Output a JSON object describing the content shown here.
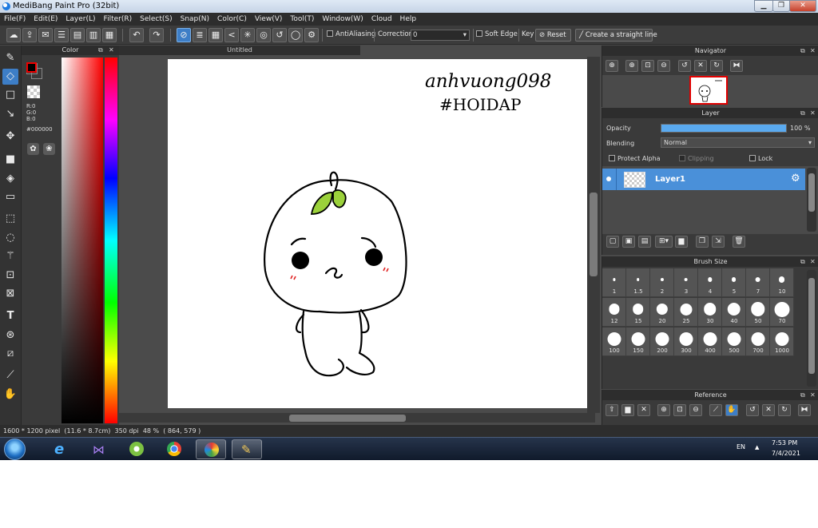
{
  "window": {
    "title": "MediBang Paint Pro (32bit)",
    "min_label": "▁",
    "max_label": "❐",
    "close_label": "✕"
  },
  "menu": [
    "File(F)",
    "Edit(E)",
    "Layer(L)",
    "Filter(R)",
    "Select(S)",
    "Snap(N)",
    "Color(C)",
    "View(V)",
    "Tool(T)",
    "Window(W)",
    "Cloud",
    "Help"
  ],
  "toolbar": {
    "antialiasing": "AntiAliasing",
    "correction_label": "Correction",
    "correction_value": "0",
    "soft_edge": "Soft Edge",
    "key": "Key",
    "reset": "Reset",
    "straight_line": "Create a straight line"
  },
  "color_panel": {
    "title": "Color",
    "r": "R:0",
    "g": "G:0",
    "b": "B:0",
    "hex": "#000000",
    "primary": "#000000",
    "secondary": "#ff0000"
  },
  "document": {
    "tab": "Untitled",
    "handwriting_line1": "anhvuong098",
    "handwriting_line2": "#HOIDAP"
  },
  "status": {
    "size": "1600 * 1200 pixel",
    "physical": "(11.6 * 8.7cm)",
    "dpi": "350 dpi",
    "zoom": "48 %",
    "coords": "( 864, 579 )"
  },
  "navigator": {
    "title": "Navigator"
  },
  "layer_panel": {
    "title": "Layer",
    "opacity_label": "Opacity",
    "opacity_value": "100 %",
    "opacity_fraction": 1.0,
    "blending_label": "Blending",
    "blending_value": "Normal",
    "protect_alpha": "Protect Alpha",
    "clipping": "Clipping",
    "lock": "Lock",
    "layers": [
      {
        "name": "Layer1",
        "selected": true,
        "visible": true
      }
    ]
  },
  "brush_size": {
    "title": "Brush Size",
    "sizes": [
      "1",
      "1.5",
      "2",
      "3",
      "4",
      "5",
      "7",
      "10",
      "12",
      "15",
      "20",
      "25",
      "30",
      "40",
      "50",
      "70",
      "100",
      "150",
      "200",
      "300",
      "400",
      "500",
      "700",
      "1000"
    ]
  },
  "reference": {
    "title": "Reference"
  },
  "taskbar": {
    "language": "EN",
    "time": "7:53 PM",
    "date": "7/4/2021"
  },
  "colors": {
    "accent": "#3d7ec7",
    "panel": "#3a3a3a",
    "toolbar": "#3c3c3c",
    "leaf": "#9bd13b"
  }
}
